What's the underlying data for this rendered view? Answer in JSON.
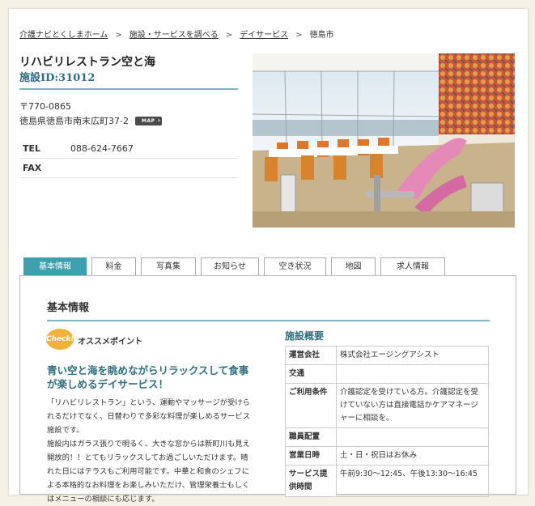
{
  "breadcrumb": {
    "items": [
      "介護ナビとくしまホーム",
      "施設・サービスを調べる",
      "デイサービス"
    ],
    "current": "徳島市",
    "separator": ">"
  },
  "facility": {
    "name": "リハビリレストラン空と海",
    "id_label": "施設ID:31012",
    "postal": "〒770-0865",
    "address": "徳島県徳島市南末広町37-2",
    "map_label": "MAP",
    "contact": [
      {
        "key": "TEL",
        "value": "088-624-7667"
      },
      {
        "key": "FAX",
        "value": ""
      }
    ]
  },
  "tabs": [
    {
      "label": "基本情報",
      "active": true
    },
    {
      "label": "料金",
      "active": false
    },
    {
      "label": "写真集",
      "active": false
    },
    {
      "label": "お知らせ",
      "active": false
    },
    {
      "label": "空き状況",
      "active": false
    },
    {
      "label": "地図",
      "active": false
    },
    {
      "label": "求人情報",
      "active": false
    }
  ],
  "main": {
    "section_title": "基本情報",
    "check_badge": "Check!",
    "recommend_label": "オススメポイント",
    "headline": "青い空と海を眺めながらリラックスして食事が楽しめるデイサービス！",
    "body": [
      "「リハビリレストラン」という、運動やマッサージが受けられるだけでなく、日替わりで多彩な料理が楽しめるサービス施設です。",
      "施設内はガラス張りで明るく、大きな窓からは新町川も見え開放的！！とてもリラックスしてお過ごしいただけます。晴れた日にはテラスもご利用可能です。中華と和食のシェフによる本格的なお料理をお楽しみいただけ、管理栄養士もしくはメニューの相談にも応じます。"
    ],
    "overview_title": "施設概要",
    "overview": [
      {
        "key": "運営会社",
        "value": "株式会社エージングアシスト"
      },
      {
        "key": "交通",
        "value": ""
      },
      {
        "key": "ご利用条件",
        "value": "介護認定を受けている方。介護認定を受けていない方は直接電話かケアマネージャーに相談を。"
      },
      {
        "key": "職員配置",
        "value": ""
      },
      {
        "key": "営業日時",
        "value": "土・日・祝日はお休み"
      },
      {
        "key": "サービス提供時間",
        "value": "午前9:30〜12:45、午後13:30〜16:45"
      }
    ]
  },
  "colors": {
    "accent": "#3fa0ad",
    "heading": "#2f6f80",
    "rule": "#7fb6c4",
    "badge": "#f0b238",
    "background": "#f4f2e6"
  }
}
